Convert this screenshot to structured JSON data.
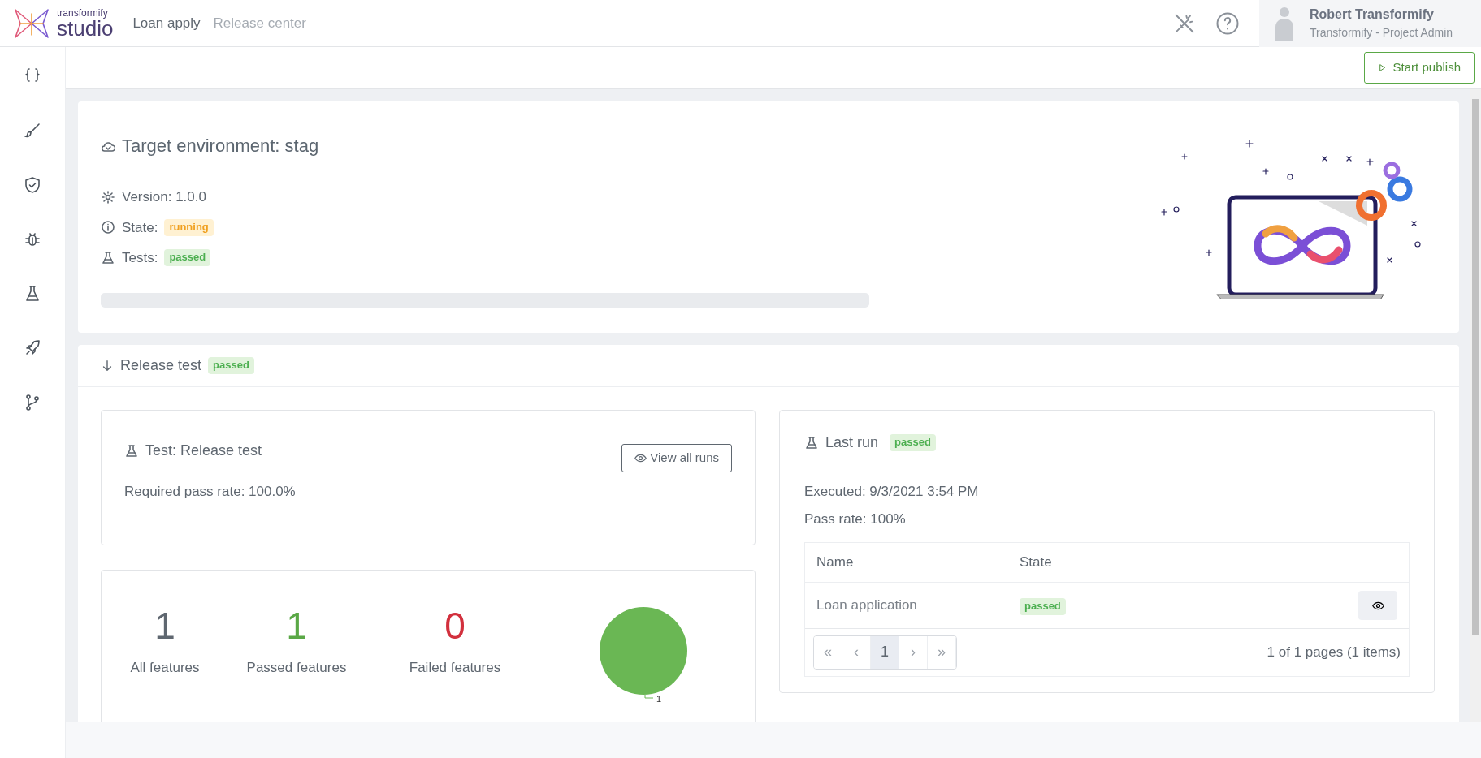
{
  "app": {
    "logo_small": "transformify",
    "logo_large": "studio"
  },
  "nav": [
    {
      "label": "Loan apply",
      "muted": false
    },
    {
      "label": "Release center",
      "muted": true
    }
  ],
  "user": {
    "name": "Robert Transformify",
    "role": "Transformify - Project Admin"
  },
  "toolbar": {
    "publish_button": "Start publish"
  },
  "environment": {
    "title": "Target environment: stag",
    "version": "Version: 1.0.0",
    "state_label": "State:",
    "state": {
      "text": "running",
      "kind": "warning"
    },
    "tests_label": "Tests:",
    "tests": {
      "text": "passed",
      "kind": "success"
    }
  },
  "release_test": {
    "title": "Release test",
    "status": {
      "text": "passed",
      "kind": "success"
    },
    "test": {
      "title": "Test: Release test",
      "required_pass_rate": "Required pass rate: 100.0%",
      "view_button": "View all runs"
    },
    "stats": [
      {
        "value": "1",
        "label": "All features",
        "color": "#5f6770"
      },
      {
        "value": "1",
        "label": "Passed features",
        "color": "#5aa846"
      },
      {
        "value": "0",
        "label": "Failed features",
        "color": "#d2303d"
      }
    ],
    "chart_data": {
      "type": "pie",
      "series": [
        {
          "color": "#6ab754",
          "values": [
            1
          ]
        }
      ],
      "data_labels": true
    }
  },
  "last_run": {
    "title": "Last run",
    "status": {
      "text": "passed",
      "kind": "success"
    },
    "executed": "Executed: 9/3/2021 3:54 PM",
    "pass_rate": "Pass rate: 100%",
    "table": {
      "columns": [
        "Name",
        "State"
      ],
      "rows": [
        {
          "name": "Loan application",
          "state": {
            "text": "passed",
            "kind": "success"
          }
        }
      ]
    },
    "pagination": {
      "buttons": [
        {
          "label": "«",
          "selected": false,
          "disabled": true
        },
        {
          "label": "‹",
          "selected": false,
          "disabled": true
        },
        {
          "label": "1",
          "selected": true,
          "disabled": false
        },
        {
          "label": "›",
          "selected": false,
          "disabled": true
        },
        {
          "label": "»",
          "selected": false,
          "disabled": true
        }
      ],
      "summary": "1 of 1 pages (1 items)"
    }
  }
}
